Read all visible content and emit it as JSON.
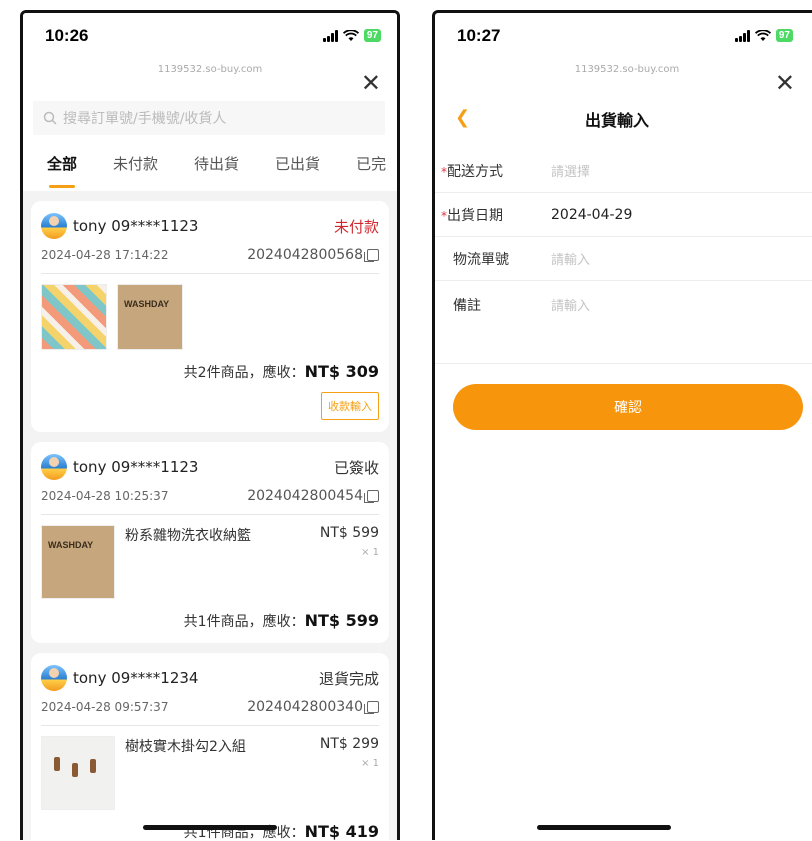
{
  "left": {
    "status_time": "10:26",
    "battery": "97",
    "url": "1139532.so-buy.com",
    "search_placeholder": "搜尋訂單號/手機號/收貨人",
    "tabs": [
      {
        "label": "全部"
      },
      {
        "label": "未付款"
      },
      {
        "label": "待出貨"
      },
      {
        "label": "已出貨"
      },
      {
        "label": "已完"
      }
    ],
    "orders": [
      {
        "buyer": "tony 09****1123",
        "status": "未付款",
        "date": "2024-04-28 17:14:22",
        "order_no": "2024042800568",
        "summary_prefix": "共2件商品，應收：",
        "total": "NT$ 309",
        "action": "收款輸入",
        "thumb_label": "WASHDAY"
      },
      {
        "buyer": "tony 09****1123",
        "status": "已簽收",
        "date": "2024-04-28 10:25:37",
        "order_no": "2024042800454",
        "item_name": "粉系雜物洗衣收納籃",
        "item_price": "NT$ 599",
        "item_qty": "× 1",
        "summary_prefix": "共1件商品，應收：",
        "total": "NT$ 599",
        "thumb_label": "WASHDAY"
      },
      {
        "buyer": "tony 09****1234",
        "status": "退貨完成",
        "date": "2024-04-28 09:57:37",
        "order_no": "2024042800340",
        "item_name": "樹枝實木掛勾2入組",
        "item_price": "NT$ 299",
        "item_qty": "× 1",
        "summary_prefix": "共1件商品，應收：",
        "total": "NT$ 419"
      }
    ]
  },
  "right": {
    "status_time": "10:27",
    "battery": "97",
    "url": "1139532.so-buy.com",
    "title": "出貨輸入",
    "fields": [
      {
        "label": "配送方式",
        "required": "*",
        "placeholder": "請選擇"
      },
      {
        "label": "出貨日期",
        "required": "*",
        "value": "2024-04-29"
      },
      {
        "label": "物流單號",
        "placeholder": "請輸入"
      },
      {
        "label": "備註",
        "placeholder": "請輸入"
      }
    ],
    "confirm": "確認"
  },
  "colors": {
    "accent": "#f5a014",
    "unpaid": "#d0282e",
    "button": "#f7950d"
  }
}
